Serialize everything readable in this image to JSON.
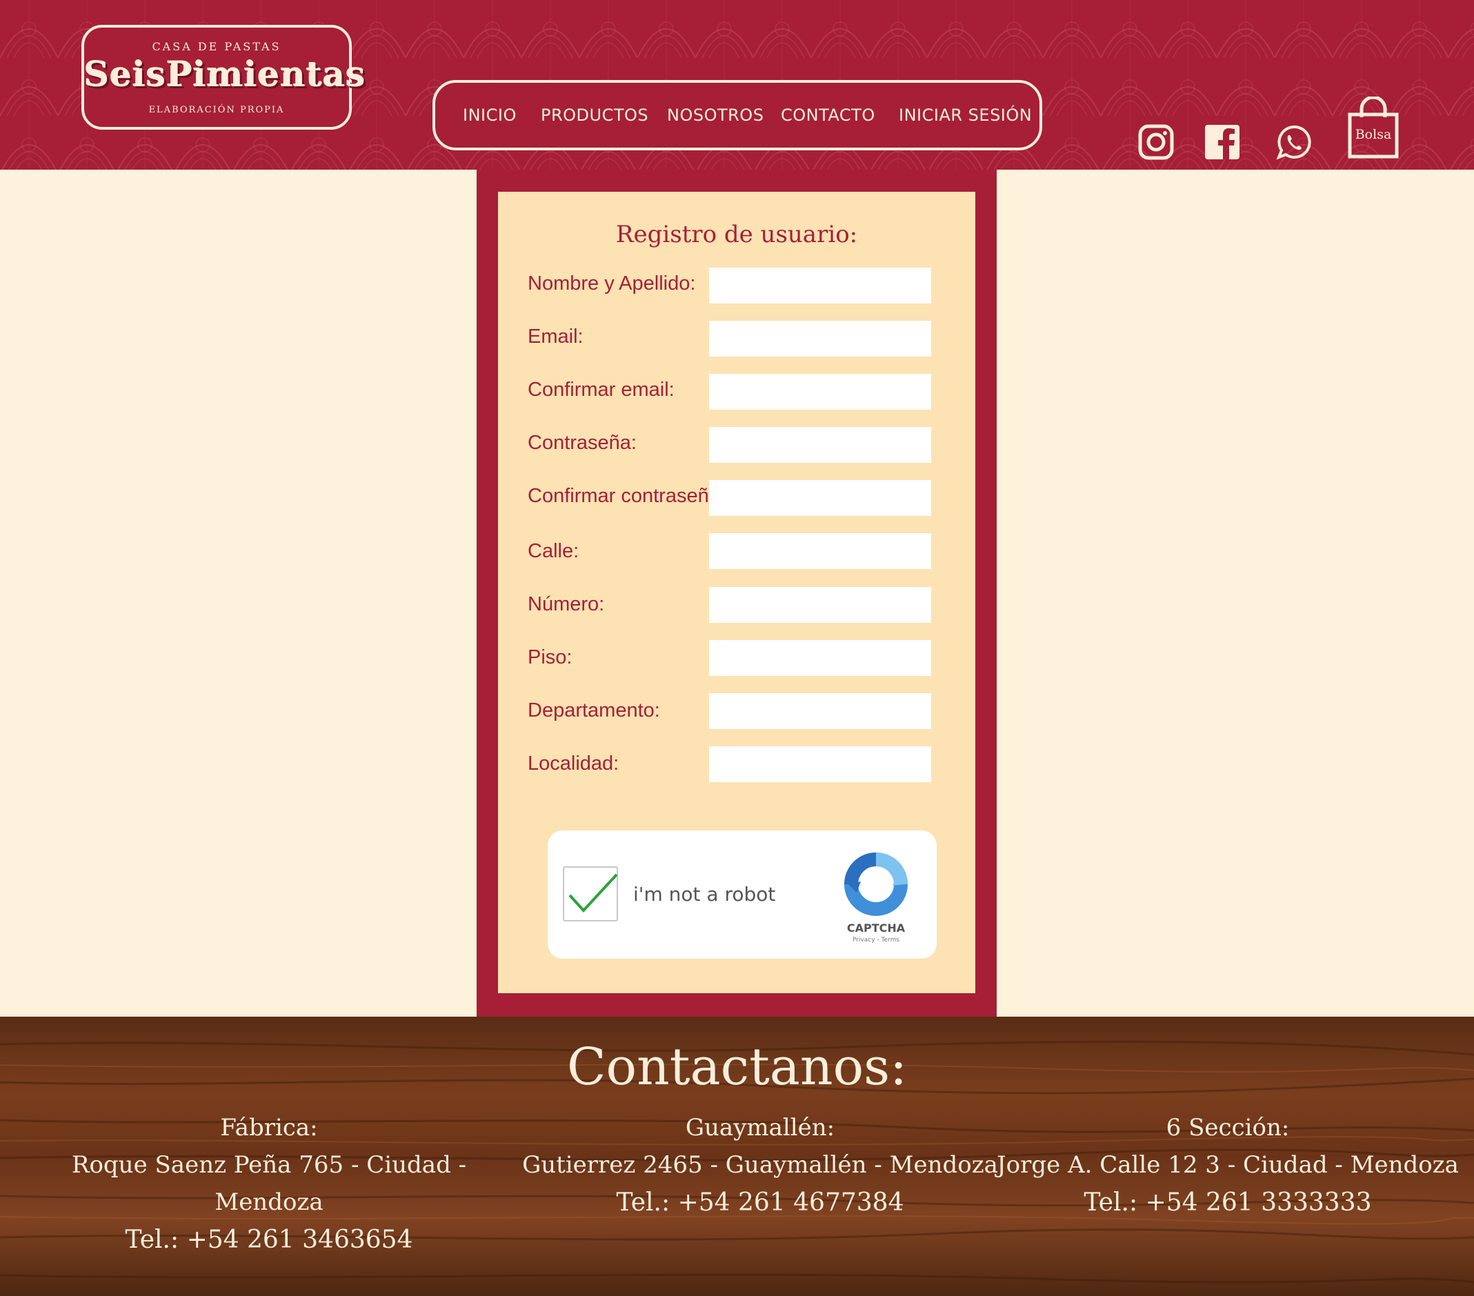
{
  "header": {
    "logo": {
      "top_line": "CASA DE PASTAS",
      "brand": "SeisPimientas",
      "bottom_line": "ELABORACIÓN PROPIA"
    },
    "nav": [
      {
        "label": "INICIO"
      },
      {
        "label": "PRODUCTOS"
      },
      {
        "label": "NOSOTROS"
      },
      {
        "label": "CONTACTO"
      },
      {
        "label": "INICIAR SESIÓN"
      }
    ],
    "social": [
      "instagram-icon",
      "facebook-icon",
      "whatsapp-icon"
    ],
    "bag_label": "Bolsa"
  },
  "form": {
    "title": "Registro de usuario:",
    "fields": [
      {
        "label": "Nombre y Apellido:",
        "value": ""
      },
      {
        "label": "Email:",
        "value": ""
      },
      {
        "label": "Confirmar email:",
        "value": ""
      },
      {
        "label": "Contraseña:",
        "value": ""
      },
      {
        "label": "Confirmar contraseña:",
        "value": ""
      },
      {
        "label": "Calle:",
        "value": ""
      },
      {
        "label": "Número:",
        "value": ""
      },
      {
        "label": "Piso:",
        "value": ""
      },
      {
        "label": "Departamento:",
        "value": ""
      },
      {
        "label": "Localidad:",
        "value": ""
      }
    ],
    "captcha": {
      "label": "i'm not a robot",
      "checked": true,
      "brand": "CAPTCHA",
      "links": "Privacy - Terms"
    }
  },
  "footer": {
    "title": "Contactanos:",
    "branches": [
      {
        "name": "Fábrica:",
        "address": "Roque Saenz Peña 765 - Ciudad - Mendoza",
        "phone": "Tel.: +54 261 3463654"
      },
      {
        "name": "Guaymallén:",
        "address": "Gutierrez 2465 - Guaymallén - Mendoza",
        "phone": "Tel.: +54 261 4677384"
      },
      {
        "name": "6 Sección:",
        "address": "Jorge A. Calle 12 3 - Ciudad - Mendoza",
        "phone": "Tel.: +54 261 3333333"
      }
    ]
  },
  "colors": {
    "brand_red": "#a61f36",
    "cream": "#fdf3dc",
    "panel": "#fde2b3",
    "light_text": "#fbeedc"
  }
}
